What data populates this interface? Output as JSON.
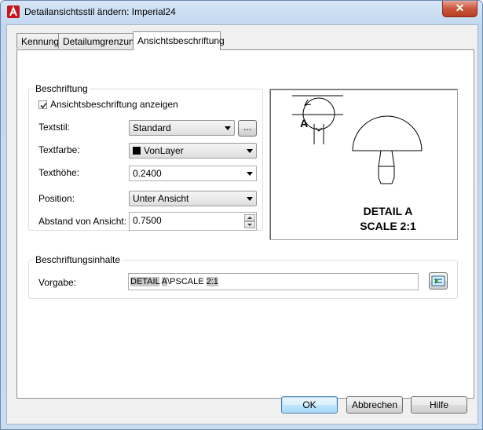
{
  "window": {
    "title": "Detailansichtsstil ändern: Imperial24",
    "close_label": "✕"
  },
  "tabs": [
    {
      "label": "Kennung",
      "active": false
    },
    {
      "label": "Detailumgrenzung",
      "active": false
    },
    {
      "label": "Ansichtsbeschriftung",
      "active": true
    }
  ],
  "beschriftung": {
    "group_title": "Beschriftung",
    "show_label": "Ansichtsbeschriftung anzeigen",
    "show_checked": true,
    "textstil_label": "Textstil:",
    "textstil_value": "Standard",
    "textstil_browse": "...",
    "textfarbe_label": "Textfarbe:",
    "textfarbe_value": "VonLayer",
    "textfarbe_color": "#000000",
    "texthoehe_label": "Texthöhe:",
    "texthoehe_value": "0.2400",
    "position_label": "Position:",
    "position_value": "Unter Ansicht",
    "abstand_label": "Abstand von Ansicht:",
    "abstand_value": "0.7500"
  },
  "preview": {
    "detail_letter": "A",
    "caption_line1": "DETAIL A",
    "caption_line2": "SCALE 2:1"
  },
  "inhalte": {
    "group_title": "Beschriftungsinhalte",
    "vorgabe_label": "Vorgabe:",
    "value_parts": [
      {
        "text": "DETAIL",
        "field": true
      },
      {
        "text": " ",
        "field": false
      },
      {
        "text": "A",
        "field": true
      },
      {
        "text": "\\PSCALE ",
        "field": false
      },
      {
        "text": "2:1",
        "field": true
      }
    ]
  },
  "buttons": {
    "ok": "OK",
    "cancel": "Abbrechen",
    "help": "Hilfe"
  },
  "colors": {
    "accent": "#3c7fb1",
    "close": "#c9573e"
  }
}
